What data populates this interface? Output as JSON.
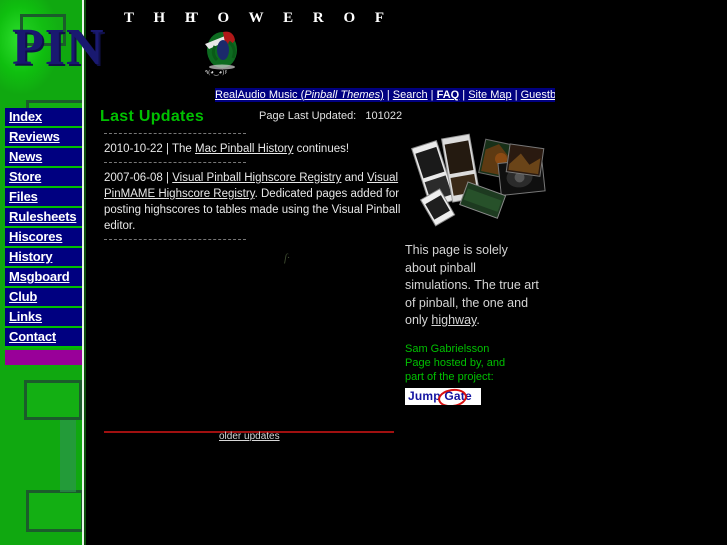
{
  "banner": {
    "line_the": "T H E",
    "line_tower_of": "T O W E R   O F",
    "line_pin": "PIN",
    "gnome_icon": "pinball-wizard-gnome-icon"
  },
  "topbar": {
    "realaudio_label": "RealAudio Music",
    "realaudio_paren_open": " (",
    "realaudio_italic": "Pinball Themes",
    "realaudio_paren_close": ")",
    "sep1": " | ",
    "search_label": "Search",
    "sep2": " | ",
    "faq_label": "FAQ",
    "sep3": " | ",
    "sitemap_label": "Site Map",
    "sep4": " | ",
    "guestbook_label": "Guestbook"
  },
  "sidebar": {
    "items": [
      {
        "label": "Index"
      },
      {
        "label": "Reviews"
      },
      {
        "label": "News"
      },
      {
        "label": "Store"
      },
      {
        "label": "Files"
      },
      {
        "label": "Rulesheets"
      },
      {
        "label": "Hiscores"
      },
      {
        "label": "History"
      },
      {
        "label": "Msgboard"
      },
      {
        "label": "Club"
      },
      {
        "label": "Links"
      },
      {
        "label": "Contact"
      }
    ],
    "accent_color": "#990099",
    "item_bg_color": "#000080",
    "divider_color": "#00c000",
    "background_color": "#12c012"
  },
  "main": {
    "title": "Last Updates",
    "title_color": "#00c000",
    "page_last_updated_label": "Page Last Updated:",
    "page_last_updated_value": "101022",
    "updates": [
      {
        "date": "2010-10-22",
        "separator": " | The ",
        "link": "Mac Pinball History",
        "tail": " continues!"
      },
      {
        "date": "2007-06-08",
        "separator": " | ",
        "link": "Visual Pinball Highscore Registry",
        "mid": " and ",
        "link2": "Visual PinMAME Highscore Registry",
        "tail": ". Dedicated pages added for posting highscores to tables made using the Visual Pinball editor."
      }
    ],
    "artifact_glyph": "ſ·",
    "older_updates_label": "older updates",
    "rule_color": "#a01010"
  },
  "right_column": {
    "photo_name": "pinball-game-boxes-photo",
    "paragraph_pre": "This page is solely about pinball simulations. The true art of pinball, the one and only ",
    "paragraph_link": "highway",
    "paragraph_post": ".",
    "credit_line_1": "Sam Gabrielsson",
    "credit_line_2": "Page hosted by, and",
    "credit_line_3": "part of the project:",
    "credit_color": "#00c000",
    "jumpgate_label": "Jump Gate",
    "jumpgate_text_color": "#1414a0",
    "jumpgate_ring_color": "#d81010"
  }
}
